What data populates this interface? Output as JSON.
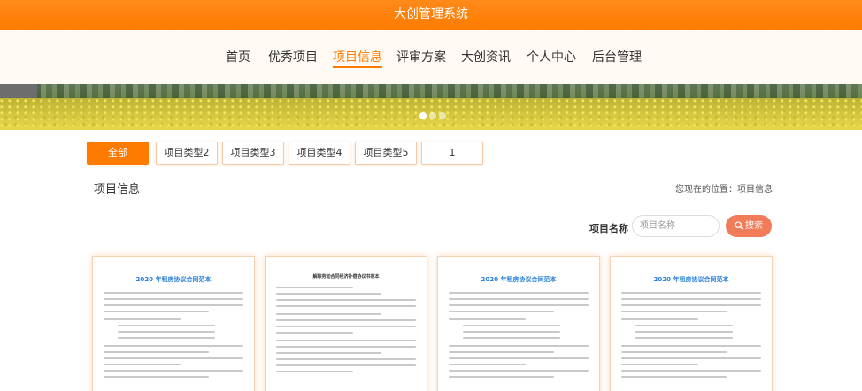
{
  "header": {
    "title": "大创管理系统"
  },
  "nav": {
    "items": [
      {
        "label": "首页"
      },
      {
        "label": "优秀项目"
      },
      {
        "label": "项目信息",
        "active": true
      },
      {
        "label": "评审方案"
      },
      {
        "label": "大创资讯"
      },
      {
        "label": "个人中心"
      },
      {
        "label": "后台管理"
      }
    ]
  },
  "banner": {
    "slide_count": 3,
    "active_slide": 1
  },
  "filters": [
    "全部",
    "项目类型2",
    "项目类型3",
    "项目类型4",
    "项目类型5",
    "1"
  ],
  "section": {
    "title": "项目信息",
    "location": "您现在的位置：项目信息"
  },
  "search": {
    "label": "项目名称",
    "placeholder": "项目名称",
    "value": "",
    "button_label": "搜索"
  },
  "cards": [
    {
      "doc_title": "2020 年租房协议合同范本"
    },
    {
      "doc_title": "解除劳动合同经济补偿协议书范本"
    },
    {
      "doc_title": "2020 年租房协议合同范本"
    },
    {
      "doc_title": "2020 年租房协议合同范本"
    }
  ],
  "colors": {
    "primary": "#ff7b00",
    "search_button": "#f07c5a",
    "doc_title_blue": "#2a7fd8"
  }
}
